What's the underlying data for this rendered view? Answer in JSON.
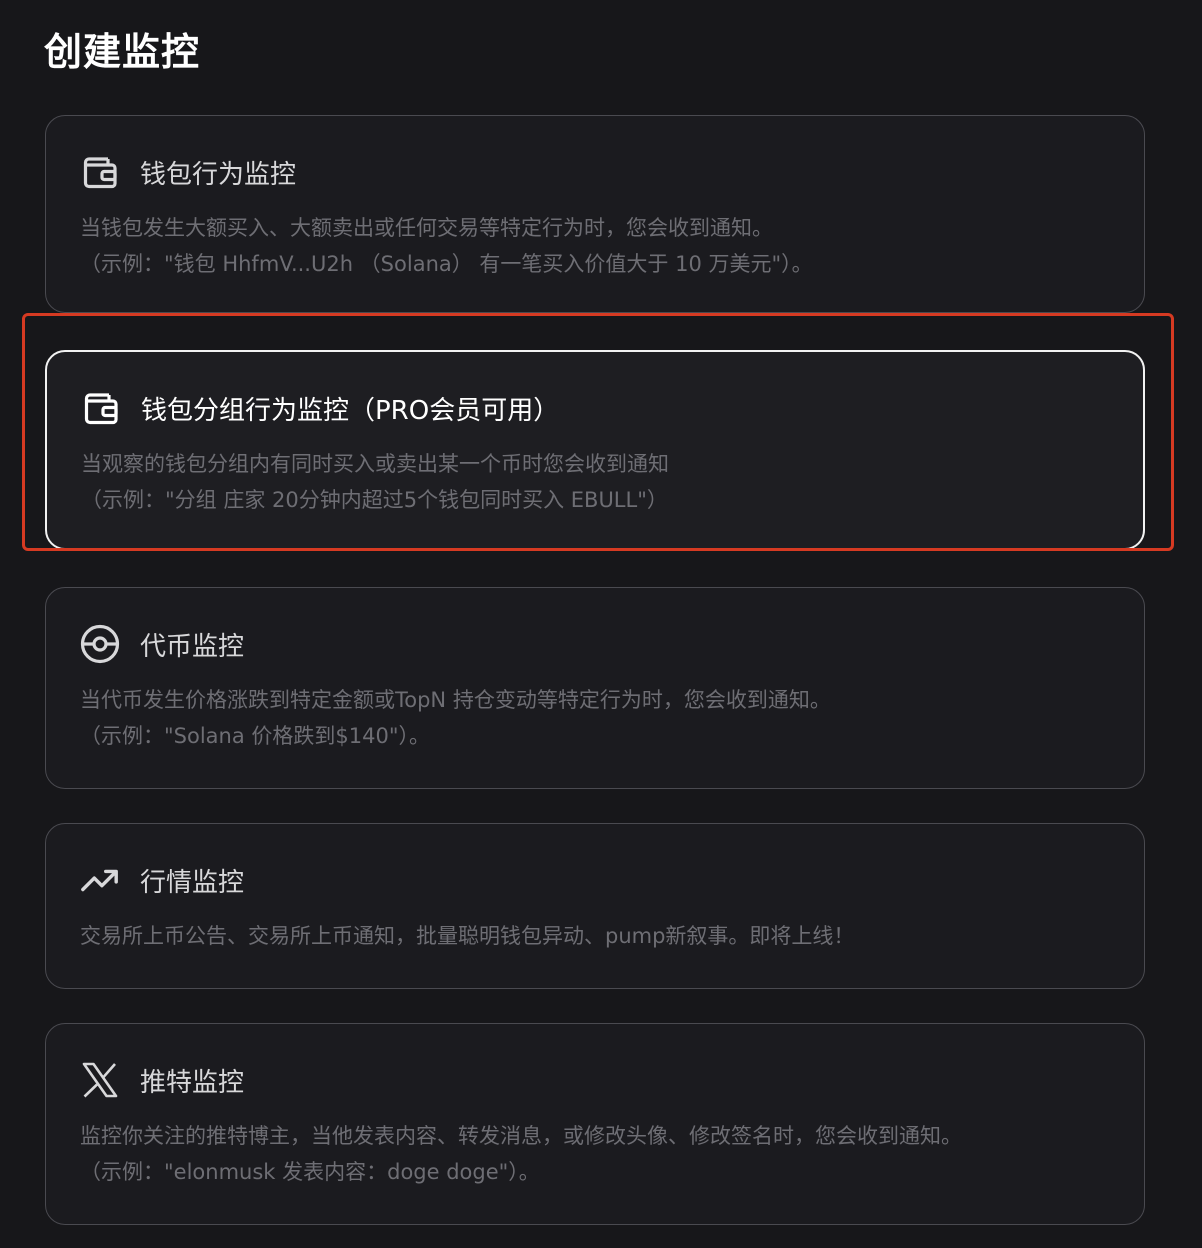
{
  "page": {
    "title": "创建监控"
  },
  "cards": [
    {
      "title": "钱包行为监控",
      "icon": "wallet-icon",
      "desc_line1": "当钱包发生大额买入、大额卖出或任何交易等特定行为时，您会收到通知。",
      "desc_line2": "（示例：\"钱包 HhfmV...U2h （Solana） 有一笔买入价值大于 10 万美元\"）。"
    },
    {
      "title": "钱包分组行为监控（PRO会员可用）",
      "icon": "wallet-icon",
      "selected": true,
      "desc_line1": "当观察的钱包分组内有同时买入或卖出某一个币时您会收到通知",
      "desc_line2": "（示例：\"分组 庄家 20分钟内超过5个钱包同时买入 EBULL\"）"
    },
    {
      "title": "代币监控",
      "icon": "token-icon",
      "desc_line1": "当代币发生价格涨跌到特定金额或TopN 持仓变动等特定行为时，您会收到通知。",
      "desc_line2": "（示例：\"Solana 价格跌到$140\"）。"
    },
    {
      "title": "行情监控",
      "icon": "trending-up-icon",
      "desc_line1": "交易所上币公告、交易所上币通知，批量聪明钱包异动、pump新叙事。即将上线！"
    },
    {
      "title": "推特监控",
      "icon": "x-logo-icon",
      "desc_line1": "监控你关注的推特博主，当他发表内容、转发消息，或修改头像、修改签名时，您会收到通知。",
      "desc_line2": "（示例：\"elonmusk 发表内容：doge doge\"）。"
    }
  ],
  "colors": {
    "background": "#17171a",
    "card_border": "#4a4a50",
    "active_border": "#f2f2f2",
    "highlight": "#d63a22",
    "description_text": "#6e6e74"
  }
}
